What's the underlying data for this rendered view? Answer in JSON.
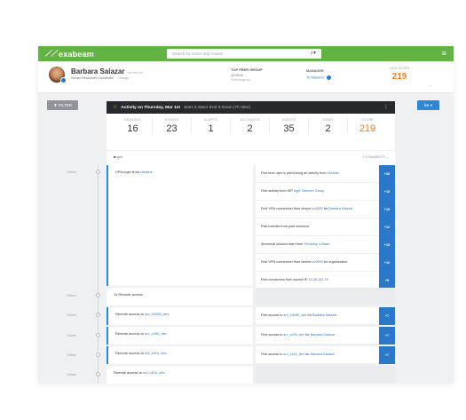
{
  "app": {
    "logo": "exabeam",
    "search_placeholder": "Search for Users and Assets"
  },
  "user": {
    "name": "Barbara Salazar",
    "username": "barbara.sal",
    "title": "Human Resources Coordinator",
    "location": "Chicago"
  },
  "peer_group": {
    "label": "TOP PEER GROUP",
    "value": "@HRole",
    "sub": "Schema/group"
  },
  "manager": {
    "label": "MANAGER",
    "name": "Tu Nakamet"
  },
  "last_score": {
    "label": "LAST SCORE",
    "value": "219"
  },
  "toolbar": {
    "filter_label": "▼ FILTER",
    "view_label": "list ▾"
  },
  "session": {
    "title": "Activity on Thursday, Mar 1st",
    "times": "Start 3:49am  End 9:02am (7h 58m)",
    "stats": [
      {
        "label": "REASONS",
        "value": "16"
      },
      {
        "label": "EVENTS",
        "value": "23"
      },
      {
        "label": "ALERTS",
        "value": "1"
      },
      {
        "label": "ACCOUNTS",
        "value": "2"
      },
      {
        "label": "ASSETS",
        "value": "35"
      },
      {
        "label": "ZONES",
        "value": "2"
      },
      {
        "label": "SCORE",
        "value": "219"
      }
    ],
    "type_label": "vpn",
    "comments_label": "0 COMMENTS ⌄"
  },
  "timeline": {
    "times": [
      "3:49am",
      "3:49am",
      "3:52am",
      "3:52am",
      "3:53am",
      "3:54am"
    ],
    "events": [
      {
        "pre": "VPN login from ",
        "link": "Ukraine"
      },
      {
        "pre": "",
        "link": "1x Remote access"
      },
      {
        "pre": "Remote access to ",
        "link": "srv_16090_dev"
      },
      {
        "pre": "Remote access to ",
        "link": "srv_c490_dev"
      },
      {
        "pre": "Remote access to ",
        "link": "srv_c116_dev"
      },
      {
        "pre": "Remote access to ",
        "link": "srv_c116_dev"
      }
    ],
    "reasons": [
      {
        "pre": "First time user is performing an activity from ",
        "link": "Ukraine",
        "post": "",
        "score": "+30"
      },
      {
        "pre": "First activity from ISP ",
        "link": "Ihgrt Telecom Group",
        "post": "",
        "score": "+15"
      },
      {
        "pre": "First VPN connection from device ",
        "link": "cc0099",
        "post": " for ",
        "link2": "Barbara Salazar",
        "score": "+15"
      },
      {
        "pre": "Risk transfer from past sessions",
        "link": "",
        "post": "",
        "score": "+12"
      },
      {
        "pre": "Abnormal session start time ",
        "link": "Thursday 3:49am",
        "post": "",
        "score": "+15"
      },
      {
        "pre": "First VPN connection from device ",
        "link": "cc0099",
        "post": " for organization",
        "score": "+10"
      },
      {
        "pre": "First connection from source IP ",
        "link": "10.26.161.23",
        "post": "",
        "score": "+5"
      },
      {
        "pre": "First access to ",
        "link": "srv_16090_dev",
        "post": " for ",
        "link2": "Barbara Salazar",
        "score": "+7"
      },
      {
        "pre": "First access to ",
        "link": "srv_c490_dev",
        "post": " for ",
        "link2": "Barbara Salazar",
        "score": "+7"
      },
      {
        "pre": "First access to ",
        "link": "srv_c116_dev",
        "post": " for ",
        "link2": "Barbara Salazar",
        "score": "+7"
      }
    ]
  },
  "colors": {
    "brand": "#62b343",
    "accent": "#2a78c8",
    "score": "#f07f1e"
  }
}
